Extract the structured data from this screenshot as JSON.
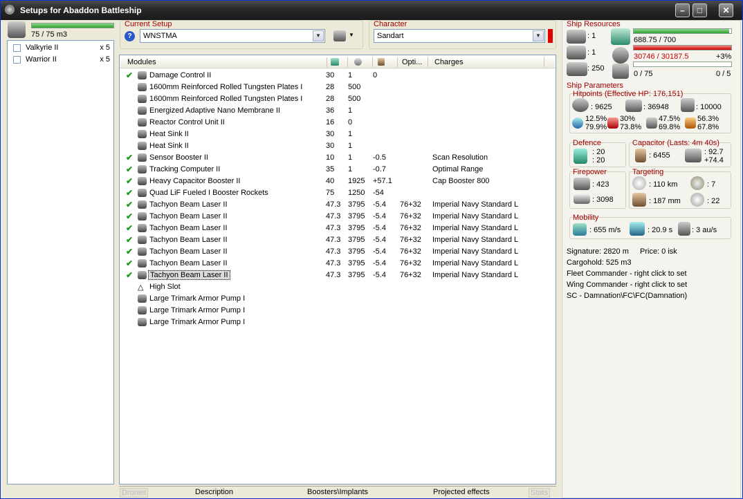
{
  "window": {
    "title": "Setups for Abaddon Battleship"
  },
  "drones": {
    "bay": "75 / 75 m3",
    "items": [
      {
        "name": "Valkyrie II",
        "qty": "x 5"
      },
      {
        "name": "Warrior II",
        "qty": "x 5"
      }
    ]
  },
  "setup": {
    "label": "Current Setup",
    "value": "WNSTMA"
  },
  "character": {
    "label": "Character",
    "value": "Sandart"
  },
  "modules": {
    "header": {
      "modules": "Modules",
      "optimal": "Opti...",
      "charges": "Charges"
    },
    "rows": [
      {
        "check": true,
        "icon": "damage-control-icon",
        "name": "Damage Control II",
        "c1": "30",
        "c2": "1",
        "c3": "0",
        "c4": "",
        "c5": ""
      },
      {
        "check": false,
        "icon": "armor-plate-icon",
        "name": "1600mm Reinforced Rolled Tungsten Plates I",
        "c1": "28",
        "c2": "500",
        "c3": "",
        "c4": "",
        "c5": ""
      },
      {
        "check": false,
        "icon": "armor-plate-icon",
        "name": "1600mm Reinforced Rolled Tungsten Plates I",
        "c1": "28",
        "c2": "500",
        "c3": "",
        "c4": "",
        "c5": ""
      },
      {
        "check": false,
        "icon": "membrane-icon",
        "name": "Energized Adaptive Nano Membrane II",
        "c1": "36",
        "c2": "1",
        "c3": "",
        "c4": "",
        "c5": ""
      },
      {
        "check": false,
        "icon": "reactor-icon",
        "name": "Reactor Control Unit II",
        "c1": "16",
        "c2": "0",
        "c3": "",
        "c4": "",
        "c5": ""
      },
      {
        "check": false,
        "icon": "heat-sink-icon",
        "name": "Heat Sink II",
        "c1": "30",
        "c2": "1",
        "c3": "",
        "c4": "",
        "c5": ""
      },
      {
        "check": false,
        "icon": "heat-sink-icon",
        "name": "Heat Sink II",
        "c1": "30",
        "c2": "1",
        "c3": "",
        "c4": "",
        "c5": ""
      },
      {
        "check": true,
        "icon": "sensor-booster-icon",
        "name": "Sensor Booster II",
        "c1": "10",
        "c2": "1",
        "c3": "-0.5",
        "c4": "",
        "c5": "Scan Resolution"
      },
      {
        "check": true,
        "icon": "tracking-computer-icon",
        "name": "Tracking Computer II",
        "c1": "35",
        "c2": "1",
        "c3": "-0.7",
        "c4": "",
        "c5": "Optimal Range"
      },
      {
        "check": true,
        "icon": "cap-booster-icon",
        "name": "Heavy Capacitor Booster II",
        "c1": "40",
        "c2": "1925",
        "c3": "+57.1",
        "c4": "",
        "c5": "Cap Booster 800"
      },
      {
        "check": true,
        "icon": "booster-rocket-icon",
        "name": "Quad LiF Fueled I Booster Rockets",
        "c1": "75",
        "c2": "1250",
        "c3": "-54",
        "c4": "",
        "c5": ""
      },
      {
        "check": true,
        "icon": "laser-icon",
        "name": "Tachyon Beam Laser II",
        "c1": "47.3",
        "c2": "3795",
        "c3": "-5.4",
        "c4": "76+32",
        "c5": "Imperial Navy Standard L"
      },
      {
        "check": true,
        "icon": "laser-icon",
        "name": "Tachyon Beam Laser II",
        "c1": "47.3",
        "c2": "3795",
        "c3": "-5.4",
        "c4": "76+32",
        "c5": "Imperial Navy Standard L"
      },
      {
        "check": true,
        "icon": "laser-icon",
        "name": "Tachyon Beam Laser II",
        "c1": "47.3",
        "c2": "3795",
        "c3": "-5.4",
        "c4": "76+32",
        "c5": "Imperial Navy Standard L"
      },
      {
        "check": true,
        "icon": "laser-icon",
        "name": "Tachyon Beam Laser II",
        "c1": "47.3",
        "c2": "3795",
        "c3": "-5.4",
        "c4": "76+32",
        "c5": "Imperial Navy Standard L"
      },
      {
        "check": true,
        "icon": "laser-icon",
        "name": "Tachyon Beam Laser II",
        "c1": "47.3",
        "c2": "3795",
        "c3": "-5.4",
        "c4": "76+32",
        "c5": "Imperial Navy Standard L"
      },
      {
        "check": true,
        "icon": "laser-icon",
        "name": "Tachyon Beam Laser II",
        "c1": "47.3",
        "c2": "3795",
        "c3": "-5.4",
        "c4": "76+32",
        "c5": "Imperial Navy Standard L"
      },
      {
        "check": true,
        "icon": "laser-icon",
        "name": "Tachyon Beam Laser II",
        "c1": "47.3",
        "c2": "3795",
        "c3": "-5.4",
        "c4": "76+32",
        "c5": "Imperial Navy Standard L",
        "selected": true
      },
      {
        "check": false,
        "icon": "high-slot-icon",
        "name": "High Slot",
        "c1": "",
        "c2": "",
        "c3": "",
        "c4": "",
        "c5": ""
      },
      {
        "check": false,
        "icon": "armor-rig-icon",
        "name": "Large Trimark Armor Pump I",
        "c1": "",
        "c2": "",
        "c3": "",
        "c4": "",
        "c5": ""
      },
      {
        "check": false,
        "icon": "armor-rig-icon",
        "name": "Large Trimark Armor Pump I",
        "c1": "",
        "c2": "",
        "c3": "",
        "c4": "",
        "c5": ""
      },
      {
        "check": false,
        "icon": "armor-rig-icon",
        "name": "Large Trimark Armor Pump I",
        "c1": "",
        "c2": "",
        "c3": "",
        "c4": "",
        "c5": ""
      }
    ]
  },
  "tabs": {
    "drones": "Drones",
    "description": "Description",
    "boosters": "Boosters\\Implants",
    "projected": "Projected effects",
    "stats": "Stats"
  },
  "resources": {
    "title": "Ship Resources",
    "turrets": ": 1",
    "launchers": ": 1",
    "calibration": ": 250",
    "cpu": "688.75 / 700",
    "cpu_fraction": 0.98,
    "powergrid": "30746 / 30187.5",
    "powergrid_fraction": 1.0,
    "powergrid_extra": "+3%",
    "drone_bandwidth": "0 / 75",
    "drones_active": "0 / 5"
  },
  "params": {
    "title": "Ship Parameters",
    "hitpoints_title": "Hitpoints (Effective HP: 176,151)",
    "shield_hp": ": 9625",
    "armor_hp": ": 36948",
    "structure_hp": ": 10000",
    "res1a": "12.5%",
    "res1b": "79.9%",
    "res2a": "30%",
    "res2b": "73.8%",
    "res3a": "47.5%",
    "res3b": "69.8%",
    "res4a": "56.3%",
    "res4b": "67.8%",
    "defence_title": "Defence",
    "def1": ": 20",
    "def2": ": 20",
    "capacitor_title": "Capacitor (Lasts: 4m 40s)",
    "cap_amount": ": 6455",
    "cap_rate1": ": 92.7",
    "cap_rate2": "+74.4",
    "firepower_title": "Firepower",
    "fire1": ": 423",
    "fire2": ": 3098",
    "targeting_title": "Targeting",
    "target_range": ": 110 km",
    "max_targets": ": 7",
    "scan_res": ": 187 mm",
    "sensor_strength": ": 22",
    "mobility_title": "Mobility",
    "velocity": ": 655 m/s",
    "agility": ": 20.9 s",
    "warp": ": 3 au/s"
  },
  "info": {
    "signature": "Signature: 2820 m",
    "price": "Price: 0 isk",
    "cargohold": "Cargohold: 525 m3",
    "fleet": "Fleet Commander - right click to set",
    "wing": "Wing Commander - right click to set",
    "sc": "SC - Damnation\\FC\\FC(Damnation)"
  },
  "colors": {
    "accent_title": "#a00000",
    "check": "#1a9a1a",
    "bar_green": "#2f9f2f",
    "bar_red": "#cc0000"
  }
}
